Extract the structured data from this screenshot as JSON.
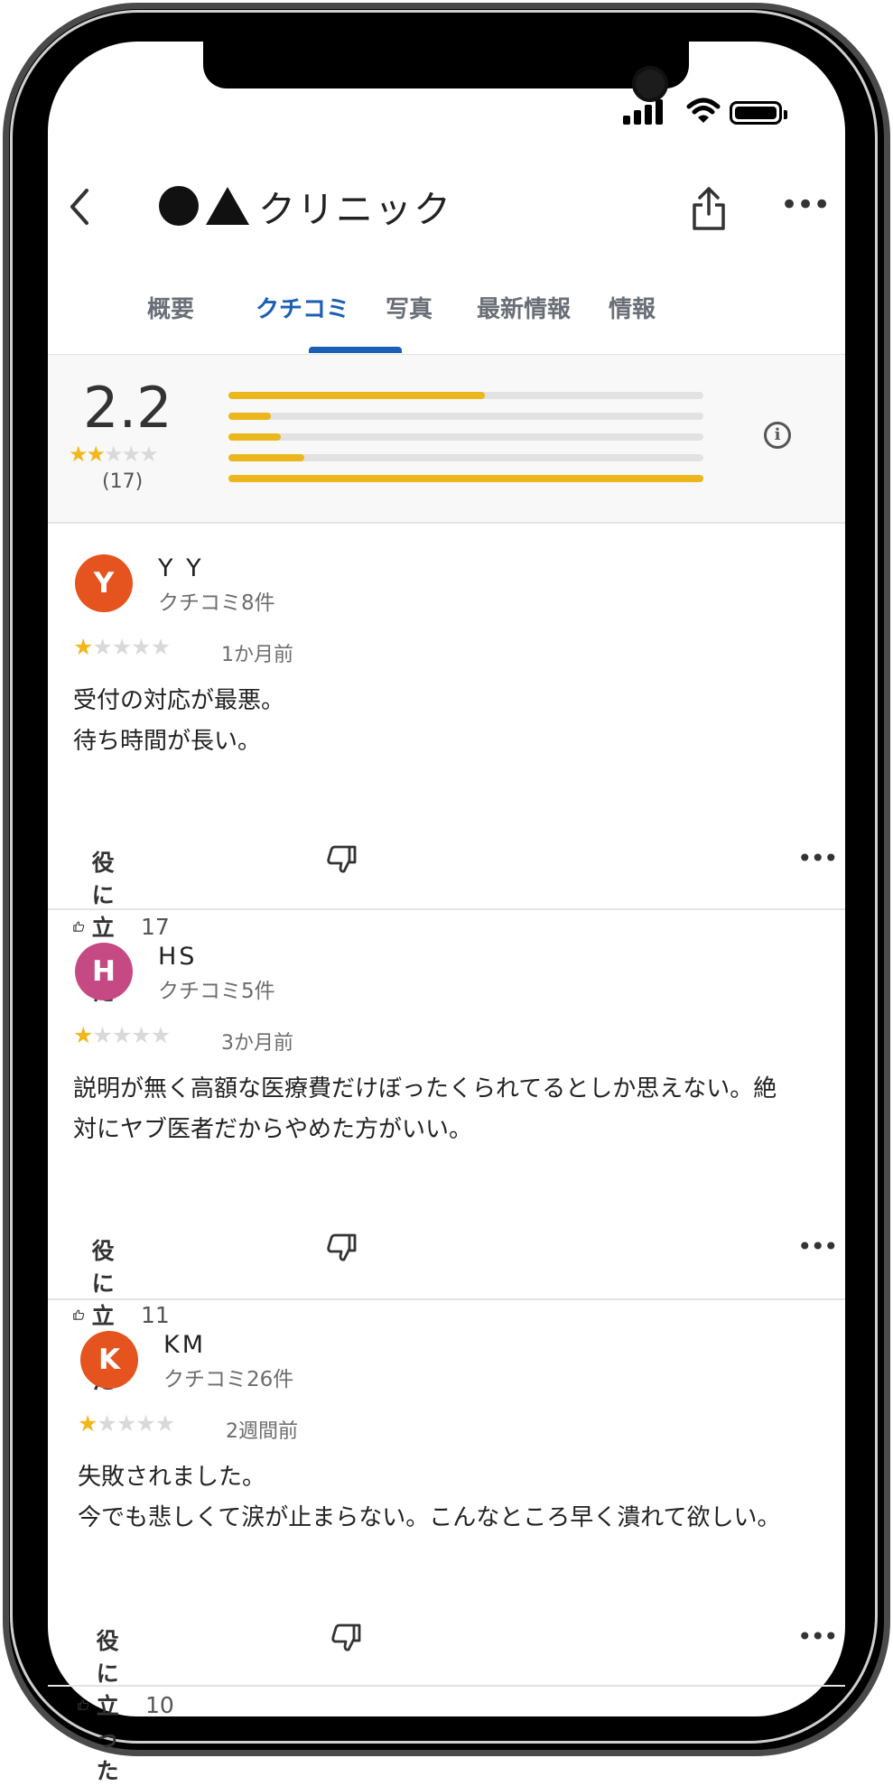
{
  "status_bar": {
    "signal_icon": "signal-bars-icon",
    "wifi_icon": "wifi-icon",
    "battery_icon": "battery-icon"
  },
  "header": {
    "back_icon": "chevron-left-icon",
    "logo": "circle-triangle-logo",
    "title": "クリニック",
    "share_icon": "share-icon",
    "more_icon": "more-horizontal-icon",
    "more_label": "•••"
  },
  "tabs": [
    {
      "label": "概要",
      "active": false
    },
    {
      "label": "クチコミ",
      "active": true
    },
    {
      "label": "写真",
      "active": false
    },
    {
      "label": "最新情報",
      "active": false
    },
    {
      "label": "情報",
      "active": false
    }
  ],
  "summary": {
    "rating": "2.2",
    "rating_value": 2.2,
    "count": "(17)",
    "distribution": [
      0.54,
      0.09,
      0.11,
      0.16,
      1.0
    ],
    "info_label": "i",
    "colors": {
      "bar": "#ebb71c",
      "track": "#e2e2e2"
    }
  },
  "reviews": [
    {
      "initial": "Y",
      "avatar_color": "#e5531f",
      "name": "Y Y",
      "review_count": "クチコミ8件",
      "stars": 1,
      "date": "1か月前",
      "text": "受付の対応が最悪。\n待ち時間が長い。",
      "helpful_label": "役に立った",
      "helpful_count": "17"
    },
    {
      "initial": "H",
      "avatar_color": "#c54a83",
      "name": "HS",
      "review_count": "クチコミ5件",
      "stars": 1,
      "date": "3か月前",
      "text": "説明が無く高額な医療費だけぼったくられてるとしか思えない。絶対にヤブ医者だからやめた方がいい。",
      "helpful_label": "役に立った",
      "helpful_count": "11"
    },
    {
      "initial": "K",
      "avatar_color": "#e5531f",
      "name": "KM",
      "review_count": "クチコミ26件",
      "stars": 1,
      "date": "2週間前",
      "text": "失敗されました。\n今でも悲しくて涙が止まらない。こんなところ早く潰れて欲しい。",
      "helpful_label": "役に立った",
      "helpful_count": "10"
    }
  ],
  "review_icons": {
    "like": "thumbs-up-icon",
    "dislike": "thumbs-down-icon",
    "more": "more-horizontal-icon",
    "more_label": "•••"
  },
  "colors": {
    "accent": "#1a5fb4",
    "star": "#f1b71c"
  }
}
